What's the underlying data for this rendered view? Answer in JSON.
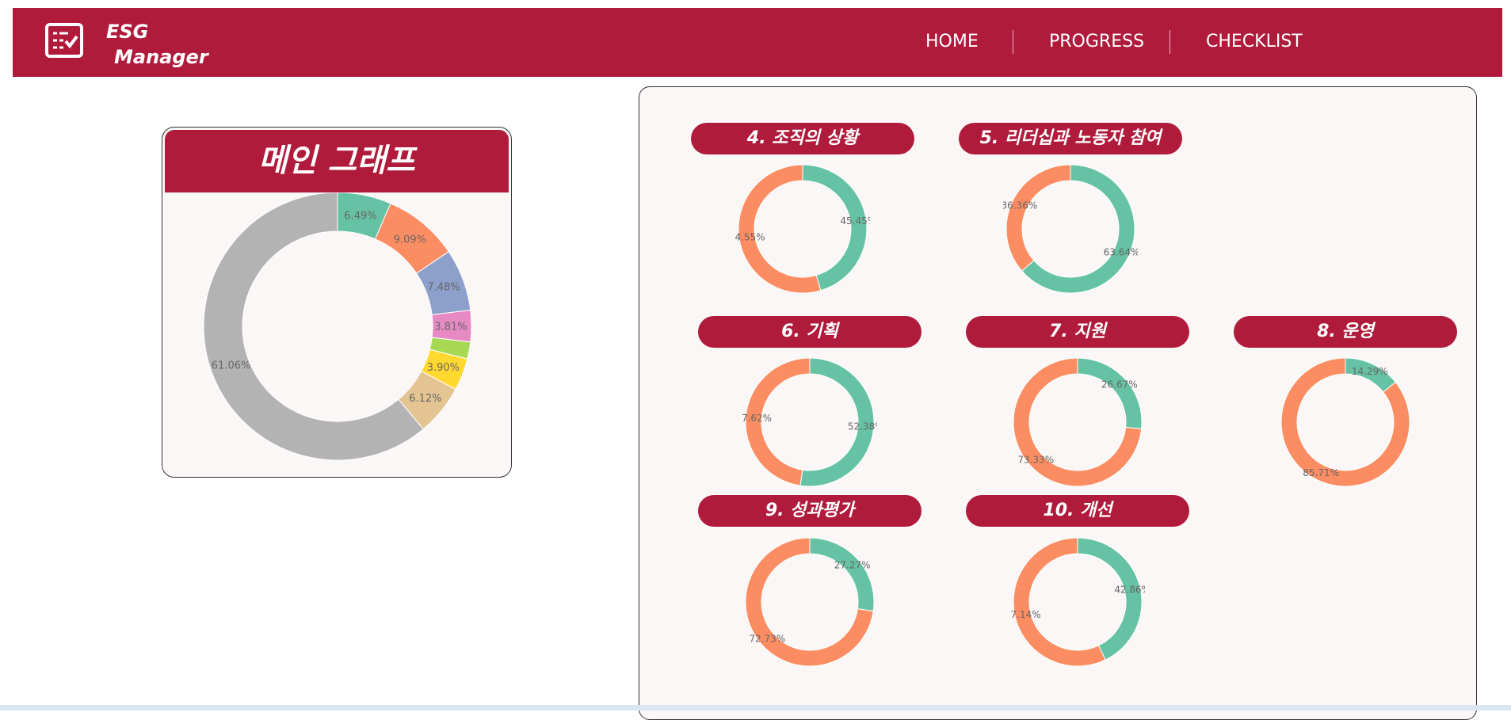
{
  "app": {
    "logo_line1": "ESG",
    "logo_line2": "Manager",
    "nav": [
      "HOME",
      "PROGRESS",
      "CHECKLIST"
    ]
  },
  "colors": {
    "brand": "#b01b3c",
    "teal": "#66c2a5",
    "orange": "#fc8d62",
    "blue": "#8da0cb",
    "pink": "#e78ac3",
    "green": "#a6d854",
    "yellow": "#ffd92f",
    "tan": "#e5c494",
    "gray": "#b3b3b3"
  },
  "main_card": {
    "title": "메인 그래프"
  },
  "chart_data": [
    {
      "type": "pie",
      "id": "main",
      "donut": true,
      "title": "메인 그래프",
      "slices": [
        {
          "value": 6.49,
          "label": "6.49%",
          "color": "#66c2a5"
        },
        {
          "value": 9.09,
          "label": "9.09%",
          "color": "#fc8d62"
        },
        {
          "value": 7.48,
          "label": "7.48%",
          "color": "#8da0cb"
        },
        {
          "value": 3.81,
          "label": "3.81%",
          "color": "#e78ac3"
        },
        {
          "value": 2.04,
          "label": "",
          "color": "#a6d854"
        },
        {
          "value": 3.9,
          "label": "3.90%",
          "color": "#ffd92f"
        },
        {
          "value": 6.12,
          "label": "6.12%",
          "color": "#e5c494"
        },
        {
          "value": 61.06,
          "label": "61.06%",
          "color": "#b3b3b3"
        }
      ]
    },
    {
      "type": "pie",
      "id": "c4",
      "donut": true,
      "title": "4. 조직의 상황",
      "slices": [
        {
          "value": 45.45,
          "label": "45.45%",
          "color": "#66c2a5"
        },
        {
          "value": 54.55,
          "label": "54.55%",
          "color": "#fc8d62"
        }
      ]
    },
    {
      "type": "pie",
      "id": "c5",
      "donut": true,
      "title": "5. 리더십과 노동자 참여",
      "slices": [
        {
          "value": 63.64,
          "label": "63.64%",
          "color": "#66c2a5"
        },
        {
          "value": 36.36,
          "label": "36.36%",
          "color": "#fc8d62"
        }
      ]
    },
    {
      "type": "pie",
      "id": "c6",
      "donut": true,
      "title": "6. 기획",
      "slices": [
        {
          "value": 52.38,
          "label": "52.38%",
          "color": "#66c2a5"
        },
        {
          "value": 47.62,
          "label": "47.62%",
          "color": "#fc8d62"
        }
      ]
    },
    {
      "type": "pie",
      "id": "c7",
      "donut": true,
      "title": "7. 지원",
      "slices": [
        {
          "value": 26.67,
          "label": "26.67%",
          "color": "#66c2a5"
        },
        {
          "value": 73.33,
          "label": "73.33%",
          "color": "#fc8d62"
        }
      ]
    },
    {
      "type": "pie",
      "id": "c8",
      "donut": true,
      "title": "8. 운영",
      "slices": [
        {
          "value": 14.29,
          "label": "14.29%",
          "color": "#66c2a5"
        },
        {
          "value": 85.71,
          "label": "85.71%",
          "color": "#fc8d62"
        }
      ]
    },
    {
      "type": "pie",
      "id": "c9",
      "donut": true,
      "title": "9. 성과평가",
      "slices": [
        {
          "value": 27.27,
          "label": "27.27%",
          "color": "#66c2a5"
        },
        {
          "value": 72.73,
          "label": "72.73%",
          "color": "#fc8d62"
        }
      ]
    },
    {
      "type": "pie",
      "id": "c10",
      "donut": true,
      "title": "10. 개선",
      "slices": [
        {
          "value": 42.86,
          "label": "42.86%",
          "color": "#66c2a5"
        },
        {
          "value": 57.14,
          "label": "57.14%",
          "color": "#fc8d62"
        }
      ]
    }
  ]
}
